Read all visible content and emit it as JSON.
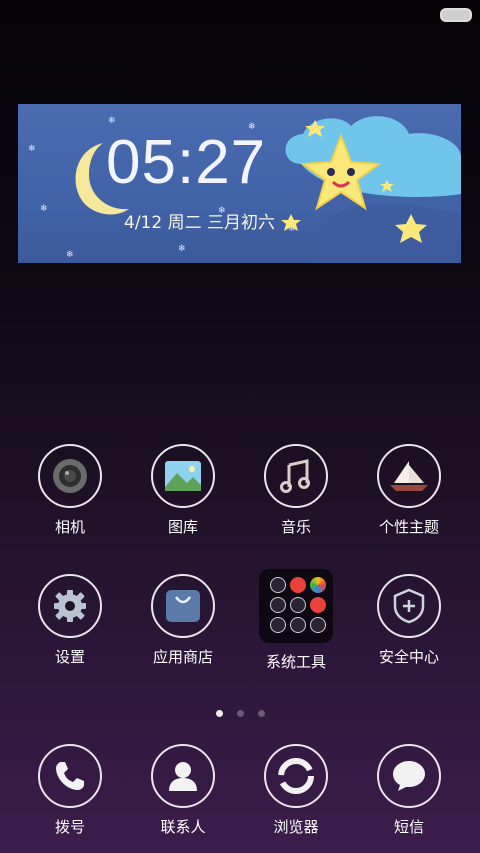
{
  "widget": {
    "time": "05:27",
    "date": "4/12  周二  三月初六"
  },
  "apps_row1": [
    {
      "label": "相机",
      "icon": "camera-icon"
    },
    {
      "label": "图库",
      "icon": "gallery-icon"
    },
    {
      "label": "音乐",
      "icon": "music-icon"
    },
    {
      "label": "个性主题",
      "icon": "theme-sailboat-icon"
    }
  ],
  "apps_row2": [
    {
      "label": "设置",
      "icon": "gear-icon"
    },
    {
      "label": "应用商店",
      "icon": "store-bag-icon"
    },
    {
      "label": "系统工具",
      "icon": "folder-icon"
    },
    {
      "label": "安全中心",
      "icon": "shield-plus-icon"
    }
  ],
  "dock": [
    {
      "label": "拨号",
      "icon": "phone-icon"
    },
    {
      "label": "联系人",
      "icon": "contact-icon"
    },
    {
      "label": "浏览器",
      "icon": "browser-icon"
    },
    {
      "label": "短信",
      "icon": "message-icon"
    }
  ],
  "page_indicator": {
    "current": 1,
    "total": 3
  },
  "colors": {
    "accent": "#4163a8",
    "moon": "#f6e79a",
    "star": "#fbe87a"
  }
}
